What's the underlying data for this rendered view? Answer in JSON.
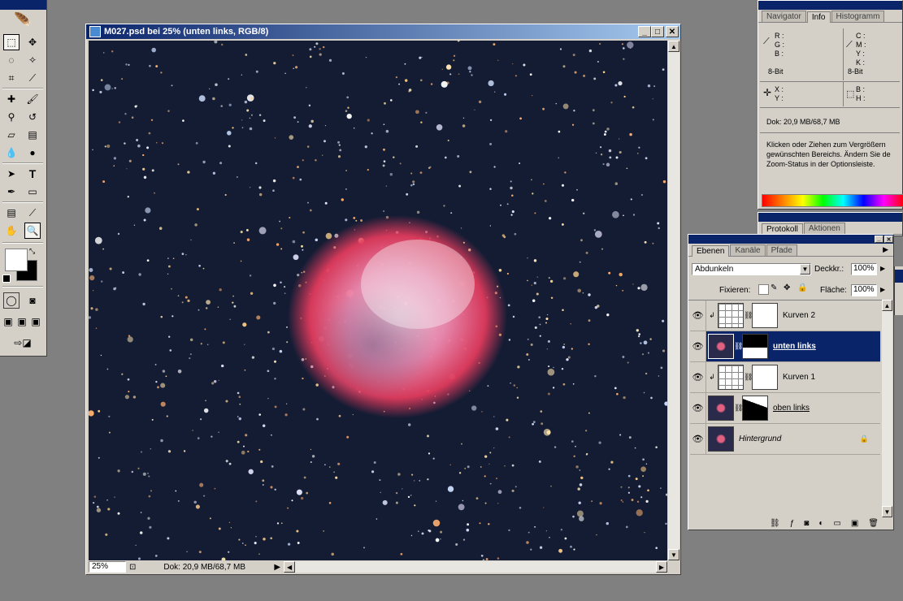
{
  "document": {
    "title": "M027.psd bei 25% (unten links, RGB/8)",
    "zoom_value": "25%",
    "status_text": "Dok: 20,9 MB/68,7 MB"
  },
  "info_panel": {
    "tabs": [
      "Navigator",
      "Info",
      "Histogramm"
    ],
    "active_tab": "Info",
    "rgb_labels": [
      "R :",
      "G :",
      "B :"
    ],
    "cmyk_labels": [
      "C :",
      "M :",
      "Y :",
      "K :"
    ],
    "bit_left": "8-Bit",
    "bit_right": "8-Bit",
    "xy_labels": [
      "X :",
      "Y :"
    ],
    "bh_labels": [
      "B :",
      "H :"
    ],
    "doc_size": "Dok: 20,9 MB/68,7 MB",
    "hint_lines": [
      "Klicken oder Ziehen zum Vergrößern",
      "gewünschten Bereichs. Ändern Sie de",
      "Zoom-Status in der Optionsleiste."
    ]
  },
  "history_panel": {
    "tabs": [
      "Protokoll",
      "Aktionen"
    ],
    "active_tab": "Protokoll"
  },
  "layers_panel": {
    "tabs": [
      "Ebenen",
      "Kanäle",
      "Pfade"
    ],
    "active_tab": "Ebenen",
    "blend_mode": "Abdunkeln",
    "opacity_label": "Deckkr.:",
    "opacity_value": "100%",
    "lock_label": "Fixieren:",
    "fill_label": "Fläche:",
    "fill_value": "100%",
    "layers": [
      {
        "name": "Kurven 2"
      },
      {
        "name": "unten links"
      },
      {
        "name": "Kurven 1"
      },
      {
        "name": "oben links"
      },
      {
        "name": "Hintergrund"
      }
    ]
  },
  "colors": {
    "title_active": "#0a246a",
    "panel_bg": "#d4d0c8",
    "nebula": "#e24a6a",
    "sky": "#111a32"
  }
}
